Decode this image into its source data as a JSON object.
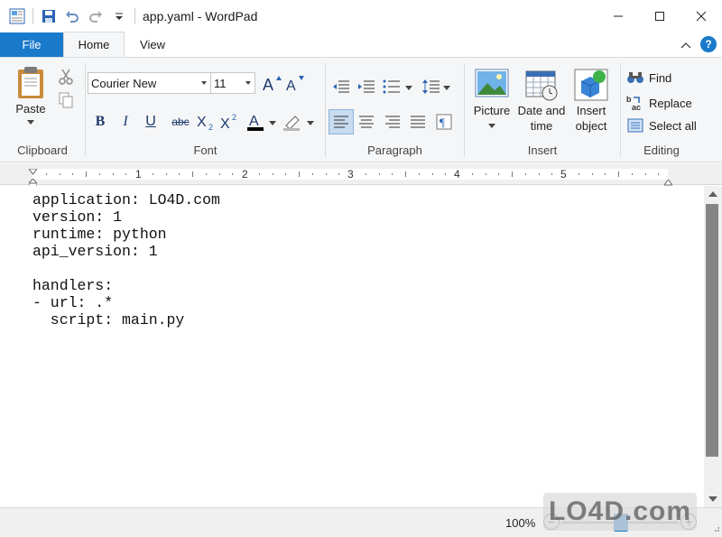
{
  "window": {
    "title": "app.yaml - WordPad"
  },
  "tabs": {
    "file": "File",
    "home": "Home",
    "view": "View"
  },
  "ribbon": {
    "clipboard": {
      "label": "Clipboard",
      "paste": "Paste"
    },
    "font": {
      "label": "Font",
      "family": "Courier New",
      "size": "11"
    },
    "paragraph": {
      "label": "Paragraph"
    },
    "insert": {
      "label": "Insert",
      "picture": "Picture",
      "datetime_line1": "Date and",
      "datetime_line2": "time",
      "object_line1": "Insert",
      "object_line2": "object"
    },
    "editing": {
      "label": "Editing",
      "find": "Find",
      "replace": "Replace",
      "select_all": "Select all"
    }
  },
  "ruler": {
    "numbers": [
      "1",
      "2",
      "3",
      "4",
      "5"
    ]
  },
  "document": {
    "lines": [
      "application: LO4D.com",
      "version: 1",
      "runtime: python",
      "api_version: 1",
      "",
      "handlers:",
      "- url: .*",
      "  script: main.py"
    ]
  },
  "status": {
    "zoom": "100%",
    "zoom_level_percent": 100
  },
  "watermark": "LO4D.com",
  "colors": {
    "accent": "#1979ca",
    "ribbon_bg": "#f5f6f7"
  }
}
